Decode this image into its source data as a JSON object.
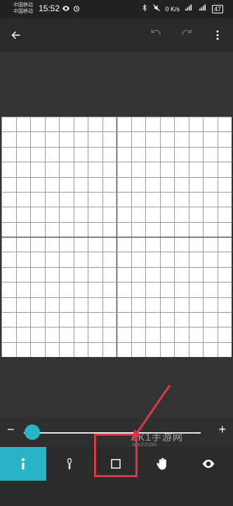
{
  "status": {
    "carrier1": "中国移动",
    "carrier2": "中国移动",
    "time": "15:52",
    "speed_top": "0",
    "speed_unit": "K/s",
    "battery": "47"
  },
  "toolbar": {
    "back_icon": "arrow-left-icon",
    "undo_icon": "undo-icon",
    "redo_icon": "redo-icon",
    "more_icon": "more-vert-icon"
  },
  "grid": {
    "cols": 16,
    "rows": 16
  },
  "slider": {
    "minus": "−",
    "plus": "+",
    "value": 0.03
  },
  "tools": [
    {
      "name": "info-tool",
      "icon": "info-icon"
    },
    {
      "name": "dropper-tool",
      "icon": "eyedropper-icon"
    },
    {
      "name": "square-tool",
      "icon": "square-icon"
    },
    {
      "name": "pan-tool",
      "icon": "hand-icon"
    },
    {
      "name": "view-tool",
      "icon": "eye-icon"
    }
  ],
  "watermark": {
    "text": "5K1手游网",
    "subtext": "5KKF.COM"
  }
}
